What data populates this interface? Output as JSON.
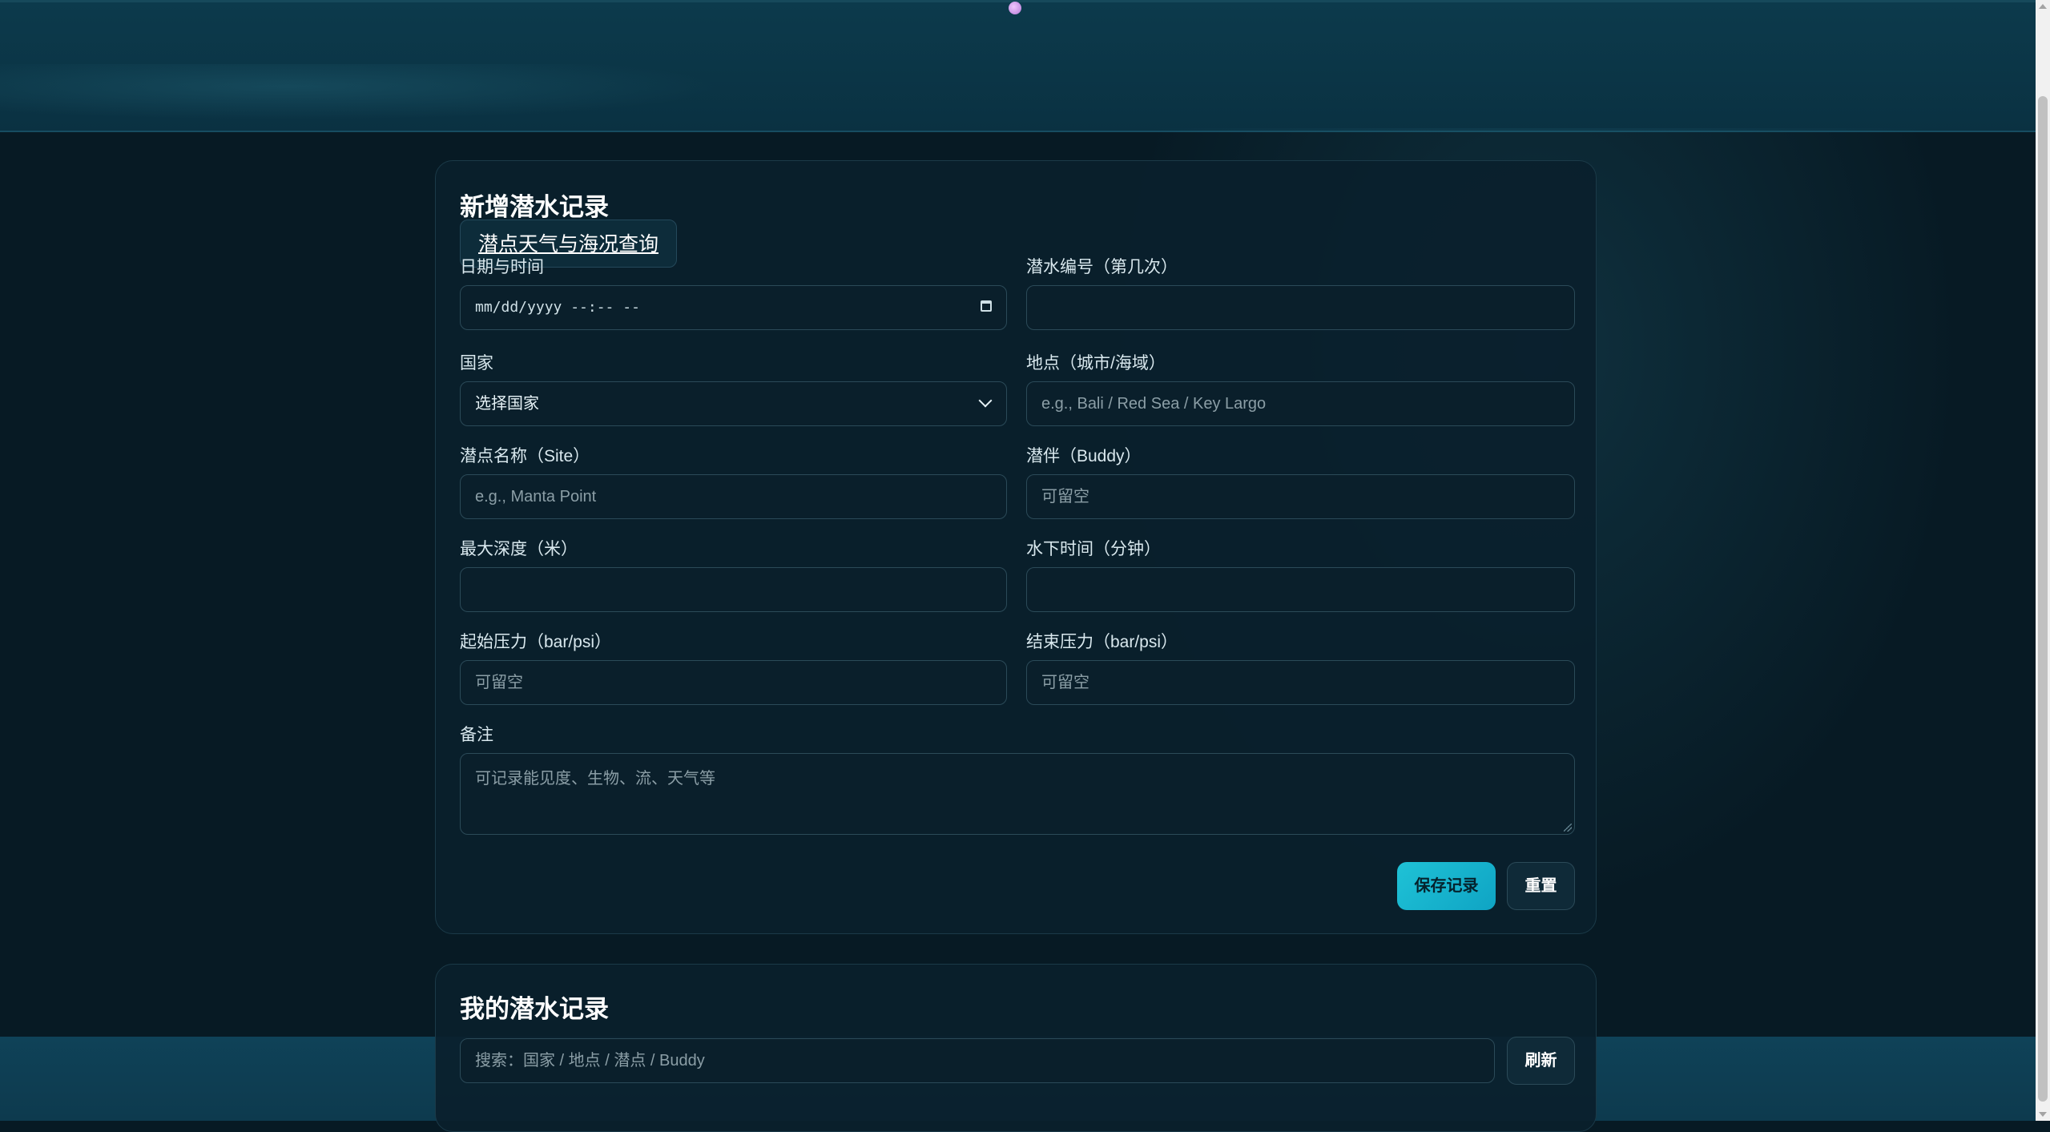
{
  "form": {
    "title": "新增潜水记录",
    "weather_link": "潜点天气与海况查询",
    "datetime": {
      "label": "日期与时间",
      "value": "mm/dd/yyyy --:-- --"
    },
    "dive_number": {
      "label": "潜水编号（第几次）",
      "value": ""
    },
    "country": {
      "label": "国家",
      "selected": "选择国家"
    },
    "location": {
      "label": "地点（城市/海域）",
      "placeholder": "e.g., Bali / Red Sea / Key Largo"
    },
    "site": {
      "label": "潜点名称（Site）",
      "placeholder": "e.g., Manta Point"
    },
    "buddy": {
      "label": "潜伴（Buddy）",
      "placeholder": "可留空"
    },
    "max_depth": {
      "label": "最大深度（米）",
      "value": ""
    },
    "bottom_time": {
      "label": "水下时间（分钟）",
      "value": ""
    },
    "start_pressure": {
      "label": "起始压力（bar/psi）",
      "placeholder": "可留空"
    },
    "end_pressure": {
      "label": "结束压力（bar/psi）",
      "placeholder": "可留空"
    },
    "notes": {
      "label": "备注",
      "placeholder": "可记录能见度、生物、流、天气等"
    },
    "save_label": "保存记录",
    "reset_label": "重置"
  },
  "records": {
    "title": "我的潜水记录",
    "search_placeholder": "搜索：国家 / 地点 / 潜点 / Buddy",
    "refresh_label": "刷新"
  },
  "colors": {
    "accent": "#1fc2d6",
    "background": "#071a24",
    "card": "#0a202c",
    "header": "#0c3a4c"
  },
  "icons": [
    "calendar-icon",
    "chevron-down-icon",
    "resize-grip-icon"
  ]
}
